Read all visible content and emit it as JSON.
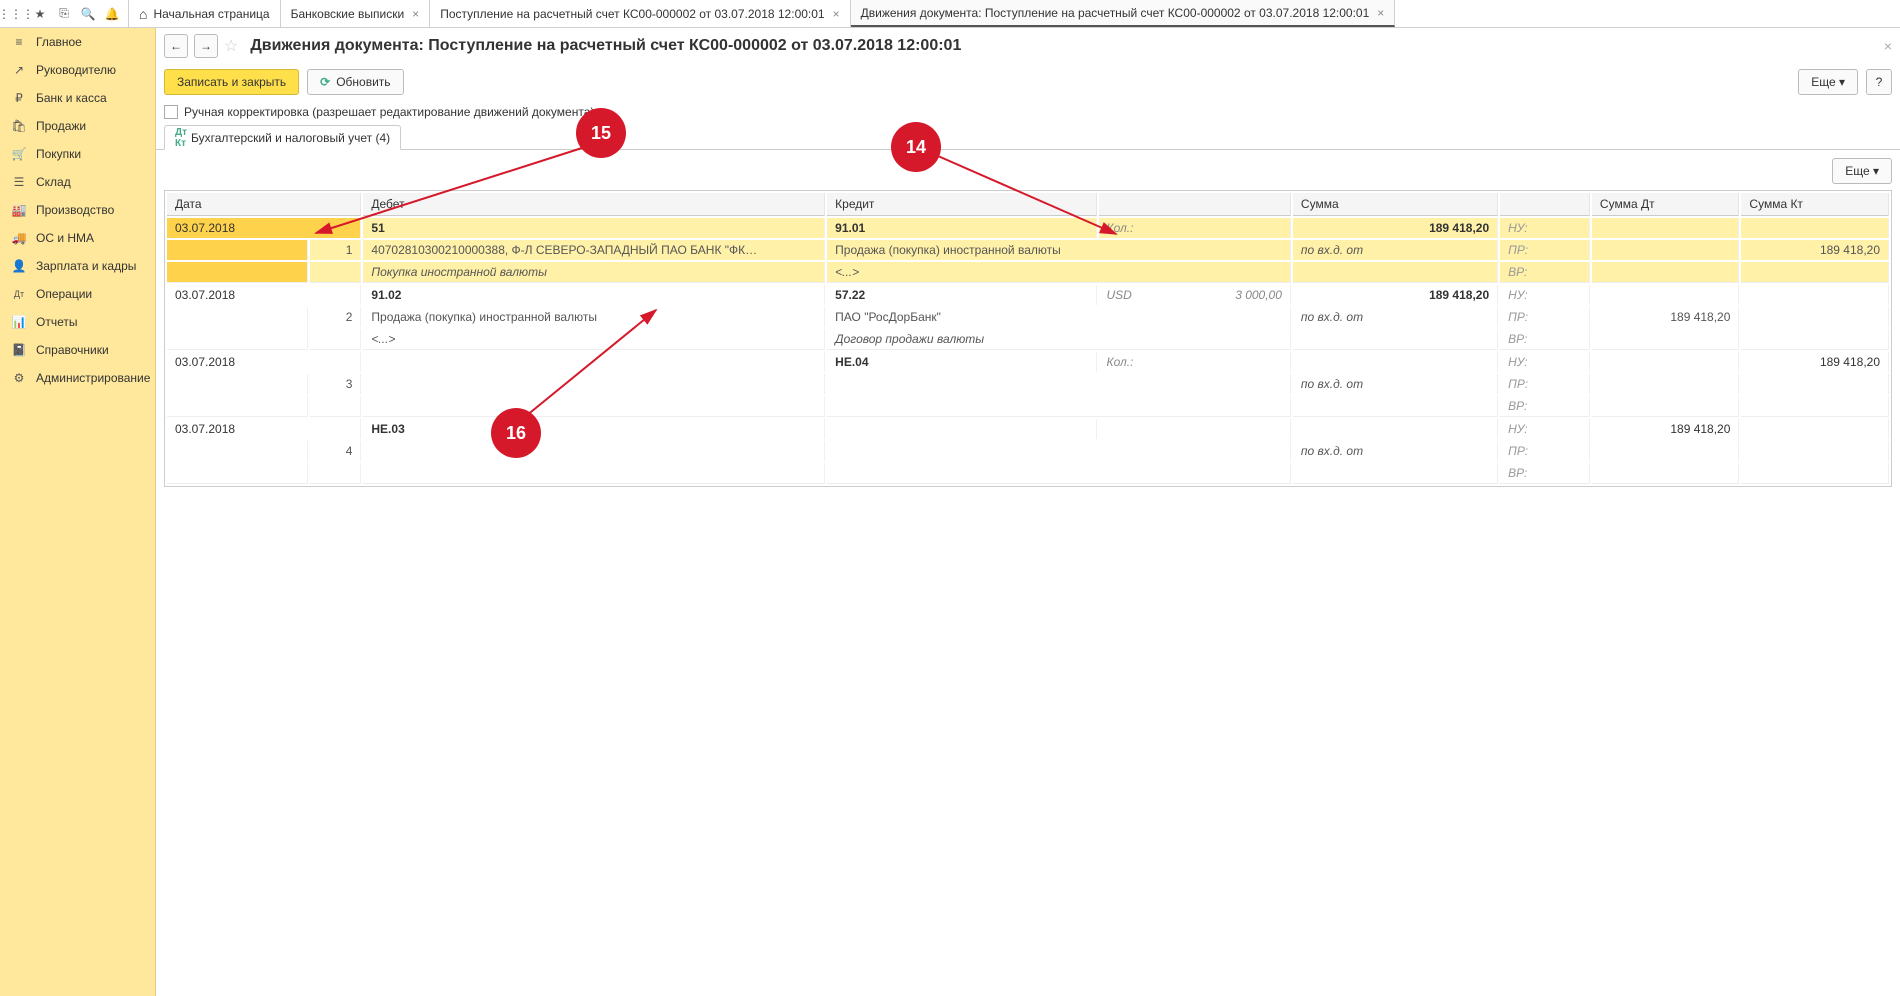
{
  "toolbar": {
    "tabs": [
      {
        "label": "Начальная страница",
        "home": true,
        "closable": false
      },
      {
        "label": "Банковские выписки",
        "closable": true
      },
      {
        "label": "Поступление на расчетный счет КС00-000002 от 03.07.2018 12:00:01",
        "closable": true
      },
      {
        "label": "Движения документа: Поступление на расчетный счет КС00-000002 от 03.07.2018 12:00:01",
        "closable": true,
        "active": true
      }
    ]
  },
  "sidebar": {
    "items": [
      {
        "icon": "≡",
        "label": "Главное"
      },
      {
        "icon": "↗",
        "label": "Руководителю"
      },
      {
        "icon": "₽",
        "label": "Банк и касса"
      },
      {
        "icon": "🛍",
        "label": "Продажи"
      },
      {
        "icon": "🛒",
        "label": "Покупки"
      },
      {
        "icon": "☰",
        "label": "Склад"
      },
      {
        "icon": "🏭",
        "label": "Производство"
      },
      {
        "icon": "🚚",
        "label": "ОС и НМА"
      },
      {
        "icon": "👤",
        "label": "Зарплата и кадры"
      },
      {
        "icon": "Дт",
        "label": "Операции"
      },
      {
        "icon": "📊",
        "label": "Отчеты"
      },
      {
        "icon": "📓",
        "label": "Справочники"
      },
      {
        "icon": "⚙",
        "label": "Администрирование"
      }
    ]
  },
  "page": {
    "title": "Движения документа: Поступление на расчетный счет КС00-000002 от 03.07.2018 12:00:01",
    "save_close": "Записать и закрыть",
    "refresh": "Обновить",
    "more": "Еще ▾",
    "help": "?",
    "manual_label": "Ручная корректировка (разрешает редактирование движений документа)",
    "tab_label": "Бухгалтерский и налоговый учет (4)",
    "columns": {
      "date": "Дата",
      "debet": "Дебет",
      "credit": "Кредит",
      "sum": "Сумма",
      "sum_dt": "Сумма Дт",
      "sum_kt": "Сумма Кт"
    },
    "qty_label": "Кол.:",
    "nu": "НУ:",
    "pr": "ПР:",
    "vr": "ВР:",
    "vxd": "по вх.д.  от",
    "entries": [
      {
        "n": "1",
        "date": "03.07.2018",
        "debet": "51",
        "debet_sub": "40702810300210000388, Ф-Л СЕВЕРО-ЗАПАДНЫЙ ПАО БАНК \"ФК…",
        "debet_sub2": "Покупка иностранной валюты",
        "credit": "91.01",
        "credit_sub": "Продажа (покупка) иностранной валюты",
        "credit_sub2": "<...>",
        "sum": "189 418,20",
        "sum_kt_pr": "189 418,20",
        "sel": true
      },
      {
        "n": "2",
        "date": "03.07.2018",
        "debet": "91.02",
        "debet_sub": "Продажа (покупка) иностранной валюты",
        "debet_sub2": "<...>",
        "credit": "57.22",
        "credit_cur": "USD",
        "credit_qty": "3 000,00",
        "credit_sub": "ПАО \"РосДорБанк\"",
        "credit_sub2": "Договор продажи валюты",
        "sum": "189 418,20",
        "sum_dt_pr": "189 418,20"
      },
      {
        "n": "3",
        "date": "03.07.2018",
        "debet": "",
        "credit": "НЕ.04",
        "sum": "",
        "sum_kt_nu": "189 418,20"
      },
      {
        "n": "4",
        "date": "03.07.2018",
        "debet": "НЕ.03",
        "credit": "",
        "sum": "",
        "sum_dt_nu": "189 418,20"
      }
    ]
  },
  "annotations": {
    "a14": "14",
    "a15": "15",
    "a16": "16"
  }
}
